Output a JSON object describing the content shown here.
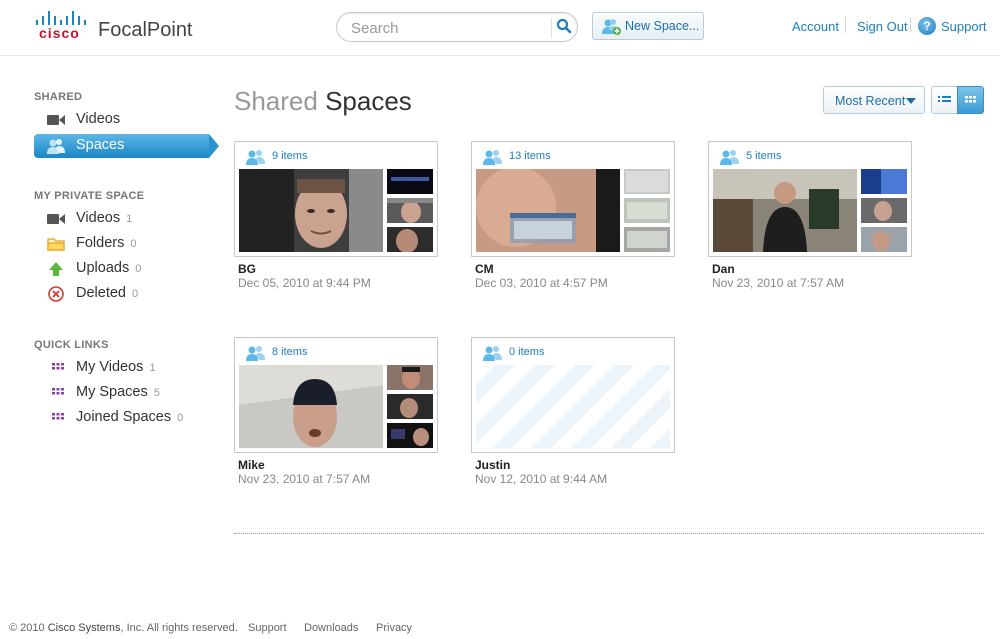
{
  "header": {
    "logo_brand": "cisco",
    "app_name": "FocalPoint",
    "search_placeholder": "Search",
    "new_space_label": "New Space...",
    "links": [
      "Account",
      "Sign Out",
      "Support"
    ]
  },
  "sidebar": {
    "sections": [
      {
        "heading": "SHARED",
        "items": [
          {
            "label": "Videos",
            "count": "",
            "icon": "video-camera-icon"
          },
          {
            "label": "Spaces",
            "count": "",
            "icon": "people-icon",
            "active": true
          }
        ]
      },
      {
        "heading": "MY PRIVATE SPACE",
        "items": [
          {
            "label": "Videos",
            "count": "1",
            "icon": "video-camera-icon"
          },
          {
            "label": "Folders",
            "count": "0",
            "icon": "folder-icon"
          },
          {
            "label": "Uploads",
            "count": "0",
            "icon": "upload-arrow-icon"
          },
          {
            "label": "Deleted",
            "count": "0",
            "icon": "delete-icon"
          }
        ]
      },
      {
        "heading": "QUICK LINKS",
        "items": [
          {
            "label": "My Videos",
            "count": "1",
            "icon": "grid-icon"
          },
          {
            "label": "My Spaces",
            "count": "5",
            "icon": "grid-icon"
          },
          {
            "label": "Joined Spaces",
            "count": "0",
            "icon": "grid-icon"
          }
        ]
      }
    ]
  },
  "main": {
    "title_light": "Shared",
    "title_dark": "Spaces",
    "sort_label": "Most Recent",
    "spaces": [
      {
        "items": "9 items",
        "name": "BG",
        "date": "Dec 05, 2010 at 9:44 PM"
      },
      {
        "items": "13 items",
        "name": "CM",
        "date": "Dec 03, 2010 at 4:57 PM"
      },
      {
        "items": "5 items",
        "name": "Dan",
        "date": "Nov 23, 2010 at 7:57 AM"
      },
      {
        "items": "8 items",
        "name": "Mike",
        "date": "Nov 23, 2010 at 7:57 AM"
      },
      {
        "items": "0 items",
        "name": "Justin",
        "date": "Nov 12, 2010 at 9:44 AM"
      }
    ]
  },
  "footer": {
    "copyright_sign": "©",
    "copyright": "2010",
    "company": "Cisco Systems",
    "rights": ", Inc. All rights reserved.",
    "links": [
      "Support",
      "Downloads",
      "Privacy"
    ]
  },
  "colors": {
    "accent": "#1b87c6",
    "link": "#1b7fc0",
    "brand_red": "#c8102e"
  }
}
